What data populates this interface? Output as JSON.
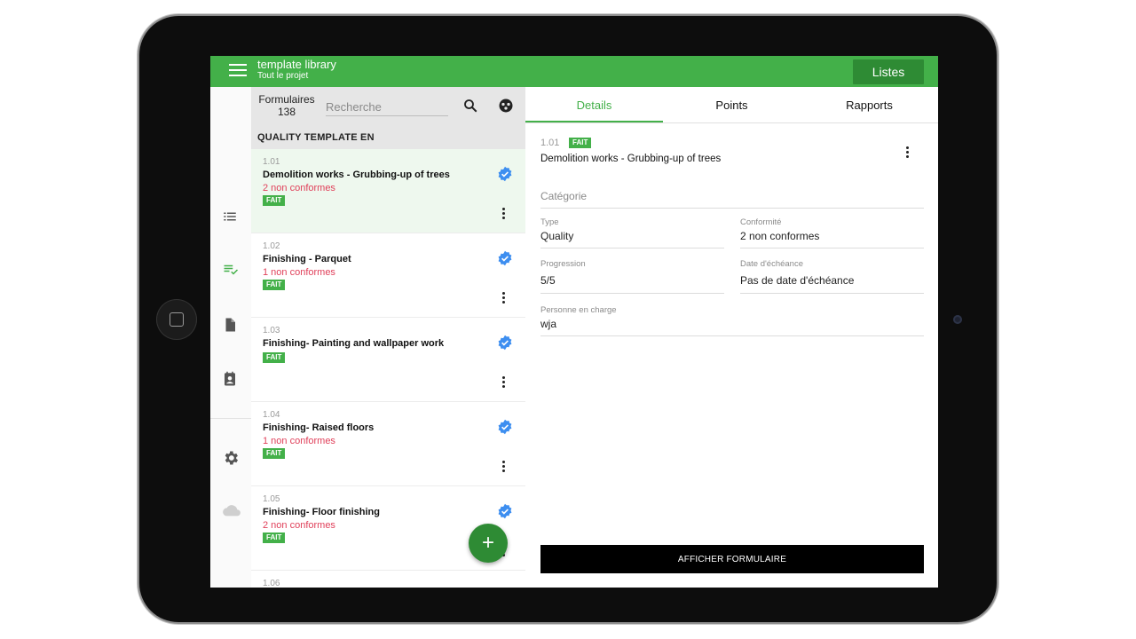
{
  "app_bar": {
    "title": "template library",
    "subtitle": "Tout le projet",
    "listes_label": "Listes"
  },
  "rail": {
    "icons": [
      "list-icon",
      "checklist-icon",
      "document-icon",
      "contact-icon",
      "gear-icon",
      "cloud-icon"
    ]
  },
  "list": {
    "forms_label": "Formulaires",
    "forms_count": "138",
    "search_placeholder": "Recherche",
    "section_title": "QUALITY TEMPLATE EN",
    "items": [
      {
        "num": "1.01",
        "name": "Demolition works - Grubbing-up of trees",
        "nc": "2 non conformes",
        "badge": "FAIT"
      },
      {
        "num": "1.02",
        "name": "Finishing - Parquet",
        "nc": "1 non conformes",
        "badge": "FAIT"
      },
      {
        "num": "1.03",
        "name": "Finishing- Painting and wallpaper work",
        "nc": "",
        "badge": "FAIT"
      },
      {
        "num": "1.04",
        "name": "Finishing- Raised floors",
        "nc": "1 non conformes",
        "badge": "FAIT"
      },
      {
        "num": "1.05",
        "name": "Finishing- Floor finishing",
        "nc": "2 non conformes",
        "badge": "FAIT"
      },
      {
        "num": "1.06",
        "name": "",
        "nc": "",
        "badge": ""
      }
    ],
    "fab_label": "+"
  },
  "detail": {
    "tabs": [
      "Details",
      "Points",
      "Rapports"
    ],
    "num": "1.01",
    "badge": "FAIT",
    "name": "Demolition works - Grubbing-up of trees",
    "category_label": "Catégorie",
    "type_label": "Type",
    "type_value": "Quality",
    "conformite_label": "Conformité",
    "conformite_value": "2 non conformes",
    "progression_label": "Progression",
    "progression_value": "5/5",
    "echeance_label": "Date d'échéance",
    "echeance_value": "Pas de date d'échéance",
    "personne_label": "Personne en charge",
    "personne_value": "wja",
    "afficher_label": "AFFICHER FORMULAIRE"
  },
  "colors": {
    "brand_green": "#43b049",
    "dark_green": "#2e8b34",
    "nonconform_red": "#e0405a",
    "check_blue": "#3d8ef0"
  }
}
